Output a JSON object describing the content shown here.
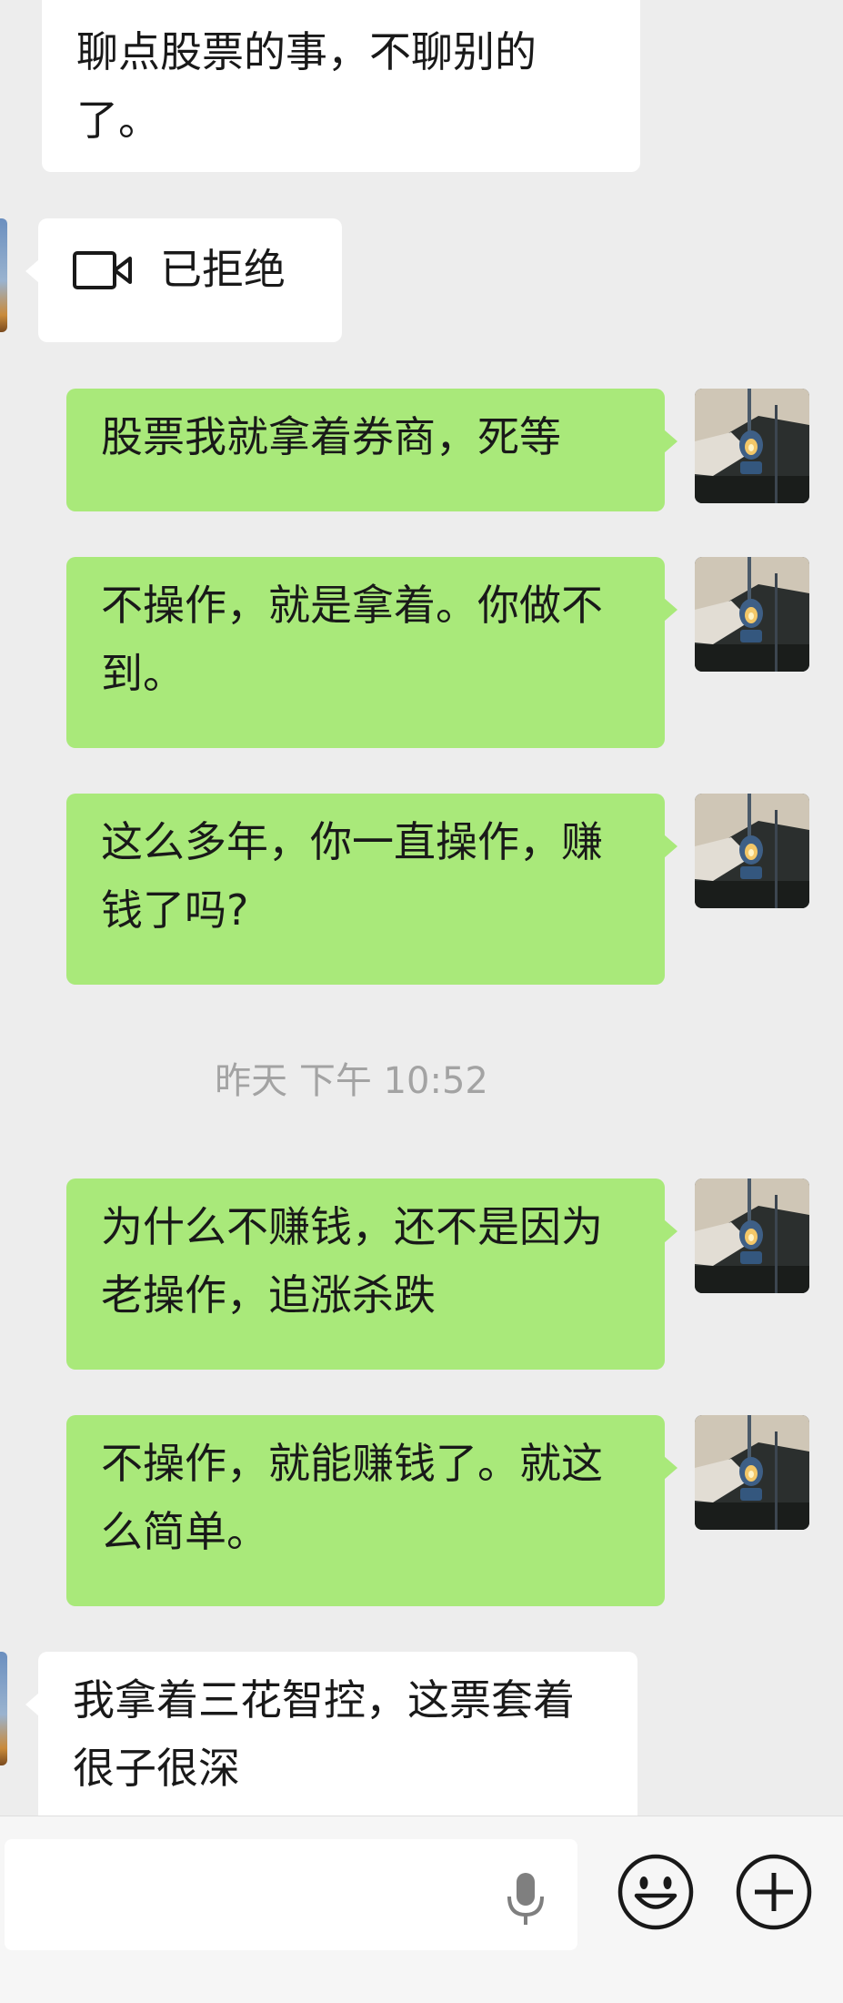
{
  "messages": {
    "m0": "聊点股票的事，不聊别的了。",
    "m1": "已拒绝",
    "m2": "股票我就拿着券商，死等",
    "m3": "不操作，就是拿着。你做不到。",
    "m4": "这么多年，你一直操作，赚钱了吗?",
    "timestamp": "昨天 下午 10:52",
    "m5": "为什么不赚钱，还不是因为老操作，追涨杀跌",
    "m6": "不操作，就能赚钱了。就这么简单。",
    "m7": "我拿着三花智控，这票套着很子很深"
  },
  "input": {
    "value": ""
  },
  "icons": {
    "video_call": "video-camera-icon",
    "voice": "microphone-icon",
    "emoji": "smiley-face-icon",
    "more": "plus-circle-icon"
  },
  "colors": {
    "background": "#ededed",
    "outgoing_bubble": "#a9e97a",
    "incoming_bubble": "#ffffff",
    "timestamp_text": "#a3a3a3"
  }
}
